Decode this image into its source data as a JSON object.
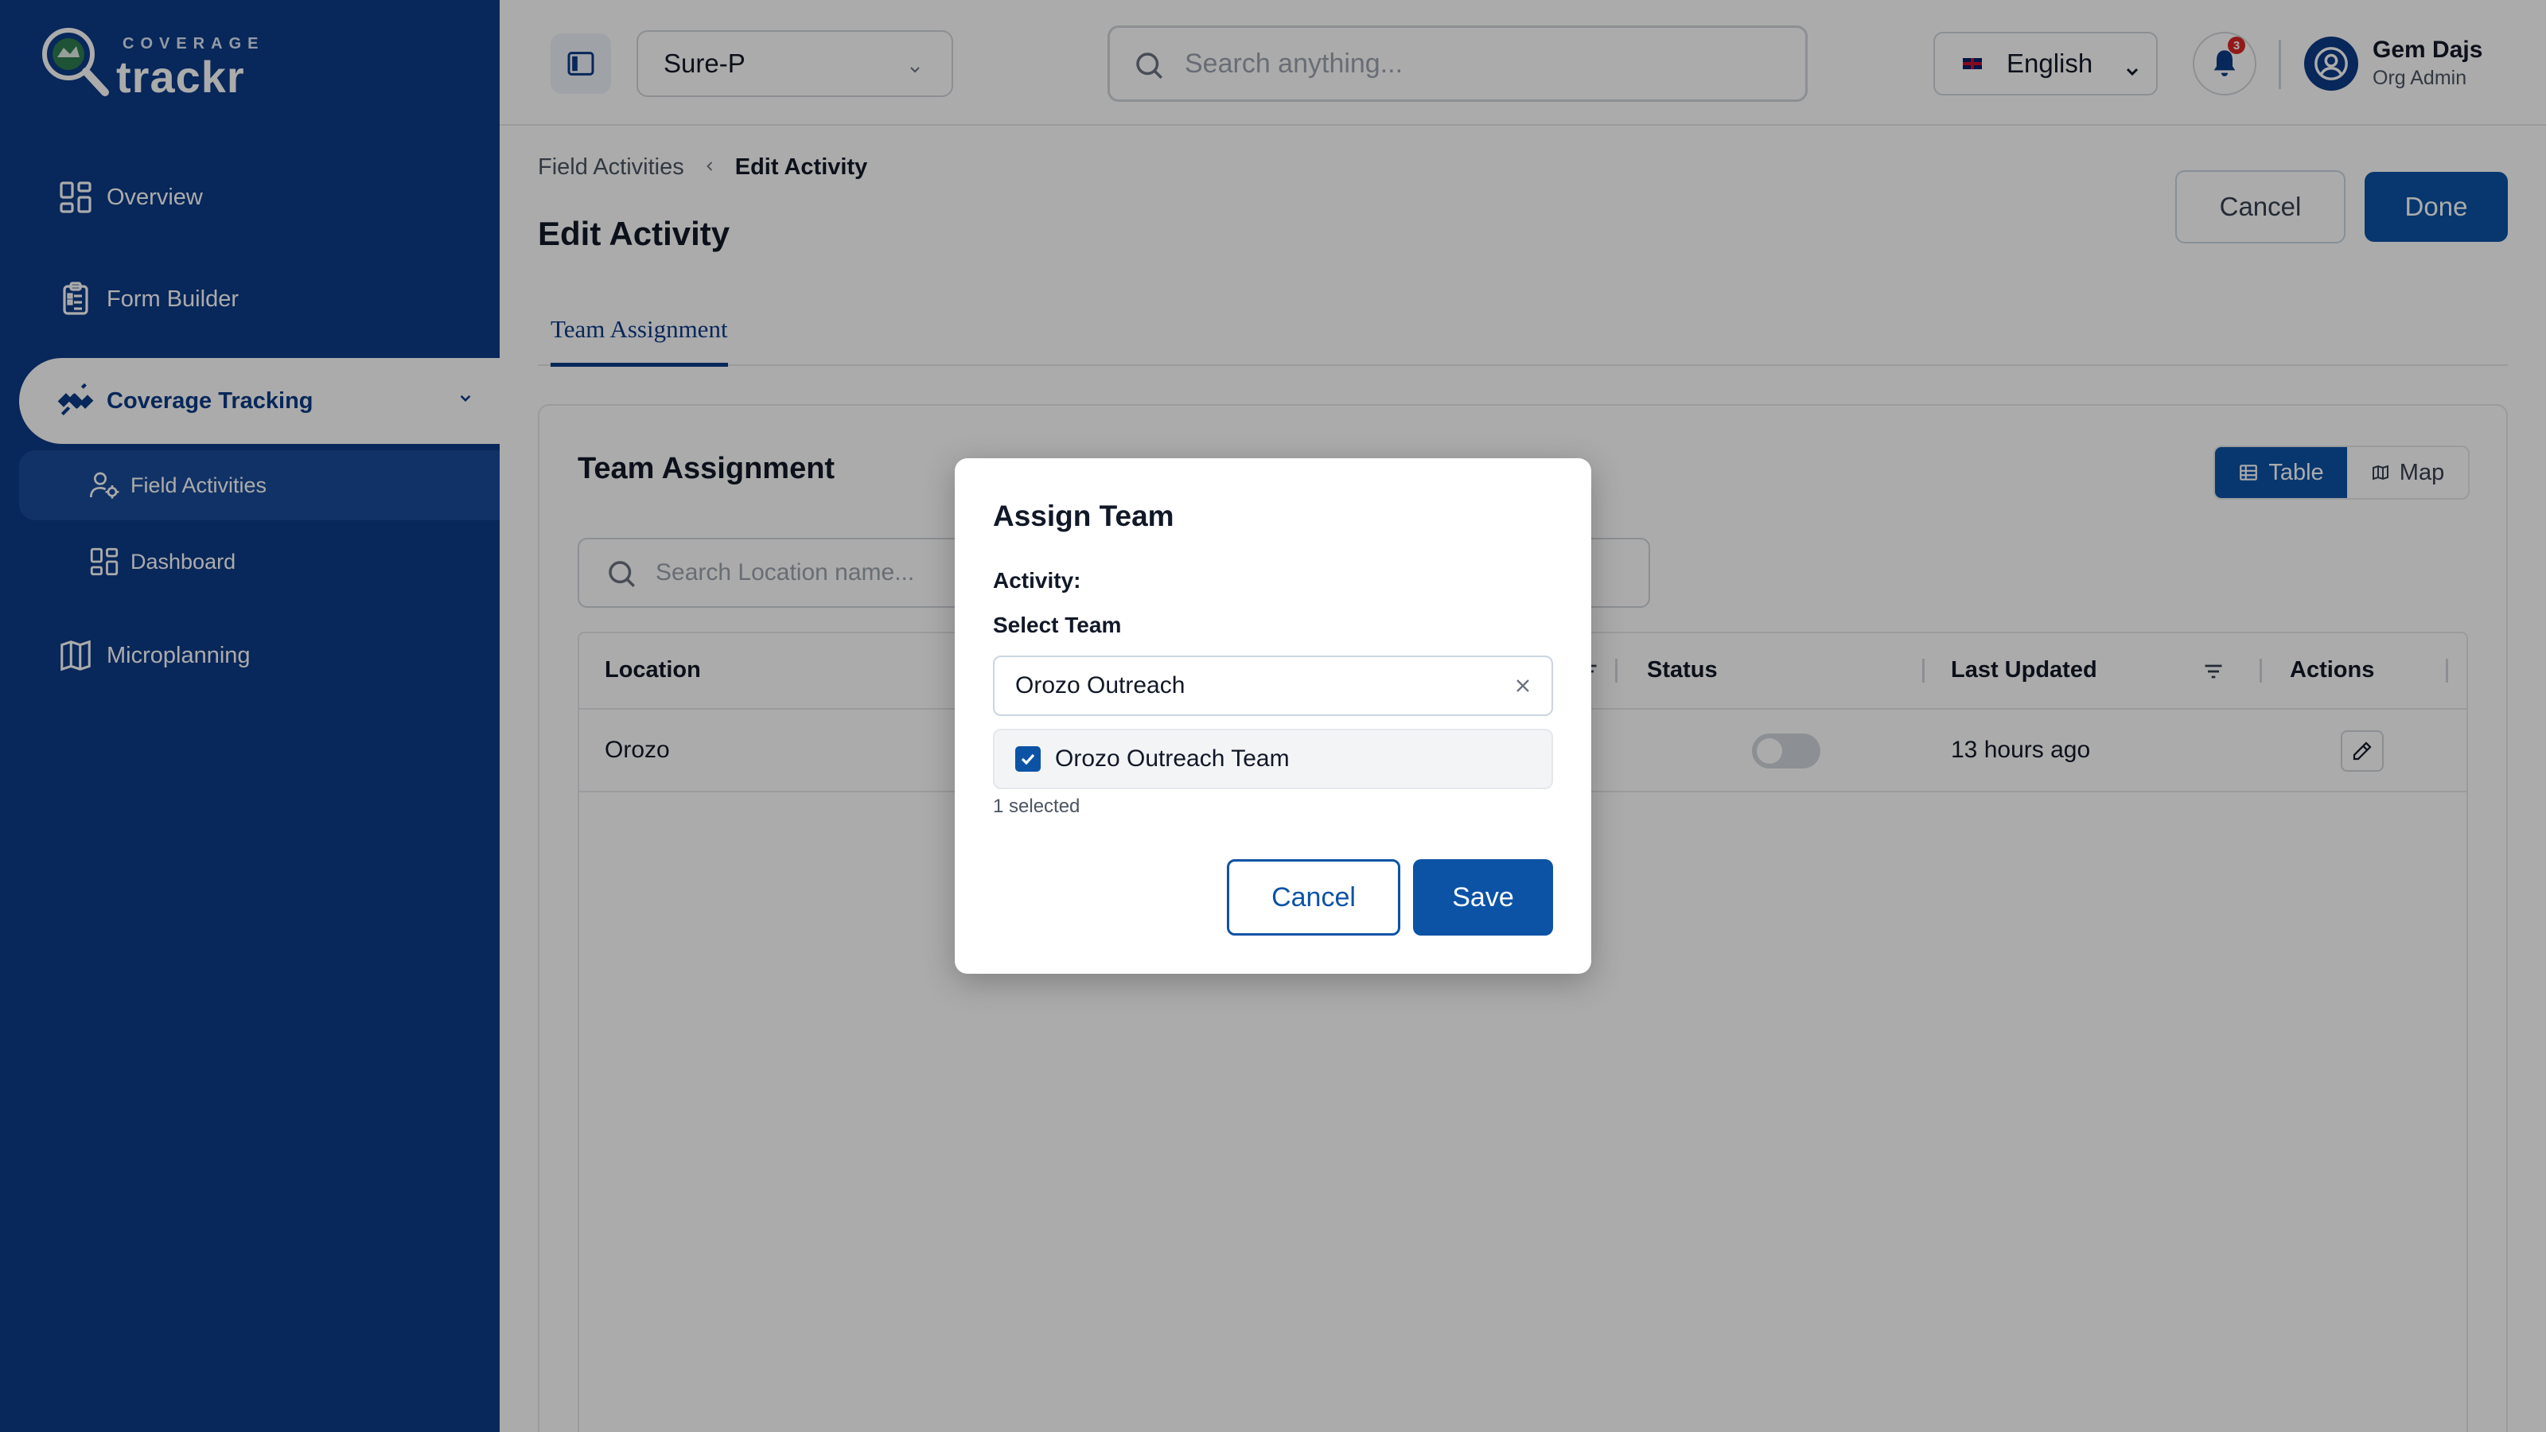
{
  "brand": {
    "small_text": "COVERAGE",
    "big_text": "trackr"
  },
  "sidebar": {
    "items": [
      {
        "label": "Overview",
        "icon": "grid-icon"
      },
      {
        "label": "Form Builder",
        "icon": "clipboard-icon"
      },
      {
        "label": "Coverage Tracking",
        "icon": "satellite-icon",
        "active": true,
        "expanded": true,
        "children": [
          {
            "label": "Field Activities",
            "icon": "user-gear-icon",
            "active": true
          },
          {
            "label": "Dashboard",
            "icon": "grid-icon"
          }
        ]
      },
      {
        "label": "Microplanning",
        "icon": "map-icon"
      }
    ]
  },
  "topbar": {
    "org_selected": "Sure-P",
    "search_placeholder": "Search anything...",
    "language": "English",
    "notification_count": "3",
    "user_name": "Gem Dajs",
    "user_role": "Org Admin"
  },
  "breadcrumb": {
    "parent": "Field Activities",
    "current": "Edit Activity"
  },
  "page": {
    "title": "Edit Activity",
    "cancel_label": "Cancel",
    "done_label": "Done",
    "tabs": [
      {
        "label": "Team Assignment",
        "active": true
      }
    ]
  },
  "panel": {
    "title": "Team Assignment",
    "view_toggle": {
      "table_label": "Table",
      "map_label": "Map",
      "active": "Table"
    },
    "search_placeholder": "Search Location name...",
    "table": {
      "columns": [
        "Location",
        "Status",
        "Last Updated",
        "Actions"
      ],
      "rows": [
        {
          "location": "Orozo",
          "status": false,
          "last_updated": "13 hours ago"
        }
      ]
    }
  },
  "modal": {
    "title": "Assign Team",
    "activity_label": "Activity:",
    "select_label": "Select Team",
    "search_value": "Orozo Outreach",
    "options": [
      {
        "label": "Orozo Outreach Team",
        "checked": true
      }
    ],
    "selected_count": "1 selected",
    "cancel_label": "Cancel",
    "save_label": "Save"
  },
  "colors": {
    "primary": "#0c3b87",
    "accent": "#0c53a6"
  }
}
